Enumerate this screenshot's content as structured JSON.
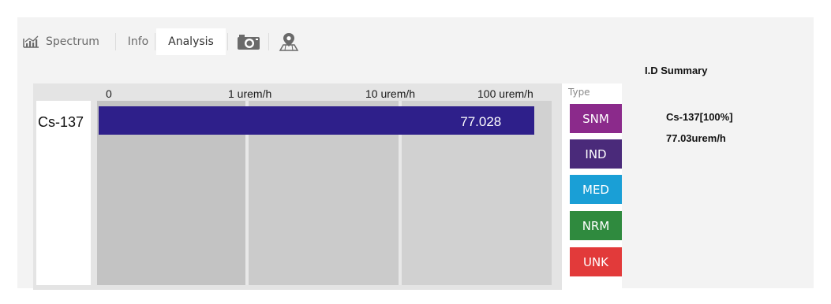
{
  "tabs": [
    {
      "label": "Spectrum",
      "icon": "spectrum-chart-icon",
      "active": false
    },
    {
      "label": "Info",
      "active": false
    },
    {
      "label": "Analysis",
      "active": true
    },
    {
      "icon": "camera-icon"
    },
    {
      "icon": "map-pin-icon"
    }
  ],
  "chart": {
    "tick_labels": [
      "0",
      "1 urem/h",
      "10 urem/h",
      "100 urem/h"
    ],
    "nuclide": "Cs-137",
    "value_label": "77.028"
  },
  "chart_data": {
    "type": "bar",
    "orientation": "horizontal",
    "scale": "log",
    "categories": [
      "Cs-137"
    ],
    "values": [
      77.028
    ],
    "xlabel": "",
    "ylabel": "",
    "x_ticks": [
      "0",
      "1 urem/h",
      "10 urem/h",
      "100 urem/h"
    ],
    "x_tick_values": [
      0.1,
      1,
      10,
      100
    ],
    "xlim": [
      0.1,
      120
    ],
    "bar_color": "#2e1f8a"
  },
  "types": {
    "header": "Type",
    "items": [
      {
        "label": "SNM",
        "color": "#8b2a8b"
      },
      {
        "label": "IND",
        "color": "#4a2a7a"
      },
      {
        "label": "MED",
        "color": "#1a9fd6"
      },
      {
        "label": "NRM",
        "color": "#2f8a3e"
      },
      {
        "label": "UNK",
        "color": "#e23a3a"
      }
    ]
  },
  "summary": {
    "title": "I.D Summary",
    "nuclide_line": "Cs-137[100%]",
    "dose_line": "77.03urem/h"
  }
}
